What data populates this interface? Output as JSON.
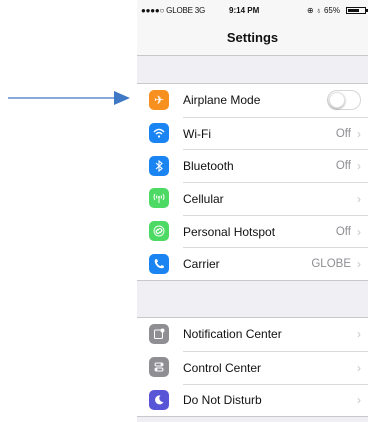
{
  "status_bar": {
    "carrier": "●●●●○ GLOBE  3G",
    "time": "9:14 PM",
    "battery": "⊕ ♁ 65%"
  },
  "nav": {
    "title": "Settings"
  },
  "colors": {
    "airplane": "#f7901e",
    "wifi": "#1a84f2",
    "bluetooth": "#1a84f2",
    "cellular": "#4cd964",
    "hotspot": "#4cd964",
    "carrier": "#1a84f2",
    "notification": "#8e8e93",
    "control": "#8e8e93",
    "dnd": "#5856d6",
    "arrow": "#3f78c4"
  },
  "group1": [
    {
      "label": "Airplane Mode",
      "value": "",
      "icon": "airplane-icon",
      "toggle_on": false
    },
    {
      "label": "Wi-Fi",
      "value": "Off",
      "icon": "wifi-icon"
    },
    {
      "label": "Bluetooth",
      "value": "Off",
      "icon": "bluetooth-icon"
    },
    {
      "label": "Cellular",
      "value": "",
      "icon": "cellular-icon"
    },
    {
      "label": "Personal Hotspot",
      "value": "Off",
      "icon": "hotspot-icon"
    },
    {
      "label": "Carrier",
      "value": "GLOBE",
      "icon": "phone-icon"
    }
  ],
  "group2": [
    {
      "label": "Notification Center",
      "value": "",
      "icon": "notification-center-icon"
    },
    {
      "label": "Control Center",
      "value": "",
      "icon": "control-center-icon"
    },
    {
      "label": "Do Not Disturb",
      "value": "",
      "icon": "moon-icon"
    }
  ],
  "chevron": "›"
}
